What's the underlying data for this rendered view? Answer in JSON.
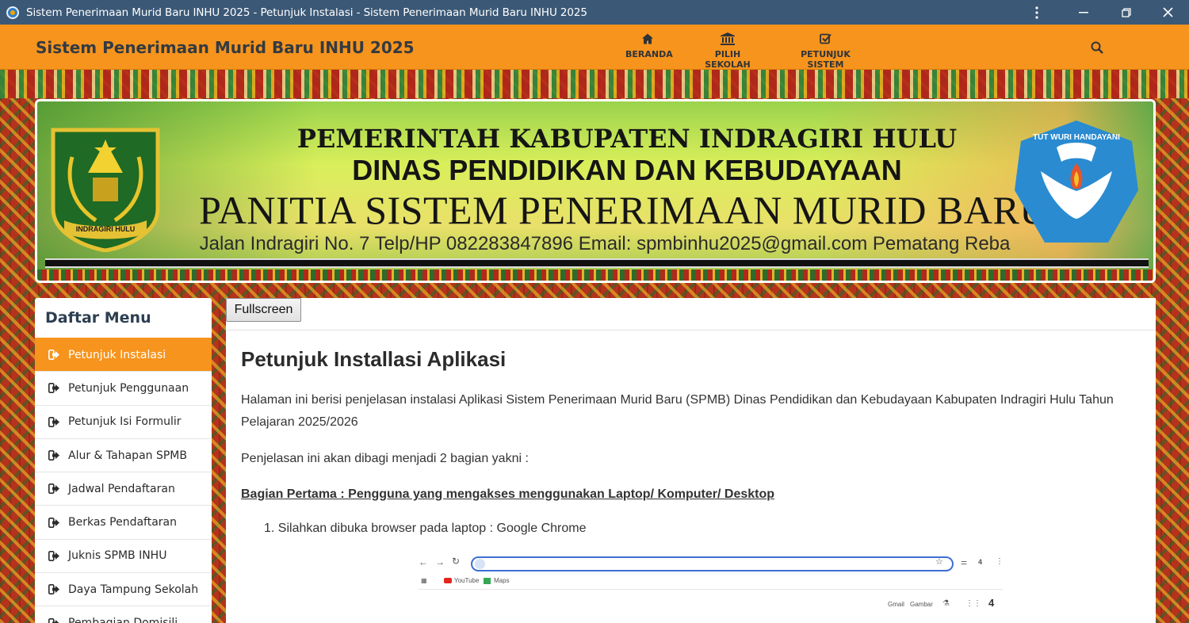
{
  "window": {
    "title": "Sistem Penerimaan Murid Baru INHU 2025 - Petunjuk Instalasi - Sistem Penerimaan Murid Baru INHU 2025"
  },
  "navbar": {
    "brand": "Sistem Penerimaan Murid Baru INHU 2025",
    "items": [
      {
        "label": "BERANDA",
        "icon": "home-icon"
      },
      {
        "label": "PILIH SEKOLAH",
        "icon": "bank-icon"
      },
      {
        "label": "PETUNJUK SISTEM",
        "icon": "checklist-icon"
      }
    ]
  },
  "banner": {
    "line1": "PEMERINTAH KABUPATEN INDRAGIRI HULU",
    "line2": "DINAS PENDIDIKAN DAN KEBUDAYAAN",
    "line3": "PANITIA SISTEM PENERIMAAN MURID BARU",
    "line4": "Jalan Indragiri No. 7 Telp/HP 082283847896 Email: spmbinhu2025@gmail.com Pematang Reba",
    "logo_left_text": "INDRAGIRI HULU",
    "logo_right_text": "TUT WURI HANDAYANI"
  },
  "sidebar": {
    "title": "Daftar Menu",
    "items": [
      {
        "label": "Petunjuk Instalasi"
      },
      {
        "label": "Petunjuk Penggunaan"
      },
      {
        "label": "Petunjuk Isi Formulir"
      },
      {
        "label": "Alur & Tahapan SPMB"
      },
      {
        "label": "Jadwal Pendaftaran"
      },
      {
        "label": "Berkas Pendaftaran"
      },
      {
        "label": "Juknis SPMB INHU"
      },
      {
        "label": "Daya Tampung Sekolah"
      },
      {
        "label": "Pembagian Domisili"
      }
    ],
    "active_index": 0
  },
  "content": {
    "fullscreen_label": "Fullscreen",
    "heading": "Petunjuk Installasi Aplikasi",
    "intro": "Halaman ini berisi penjelasan instalasi Aplikasi Sistem Penerimaan Murid Baru (SPMB) Dinas Pendidikan dan Kebudayaan Kabupaten Indragiri Hulu Tahun Pelajaran 2025/2026",
    "division": "Penjelasan ini akan dibagi menjadi 2 bagian yakni :",
    "section1": "Bagian Pertama : Pengguna yang mengakses menggunakan Laptop/ Komputer/ Desktop",
    "step1": "1. Silahkan dibuka browser pada laptop : Google Chrome"
  },
  "browser_shot": {
    "bookmark1": "YouTube",
    "bookmark2": "Maps",
    "link_gmail": "Gmail",
    "link_gambar": "Gambar",
    "tab_count": "4",
    "profile_count": "4"
  },
  "colors": {
    "navbar": "#f7941d",
    "titlebar": "#3b5876",
    "active_menu": "#f7941d"
  }
}
